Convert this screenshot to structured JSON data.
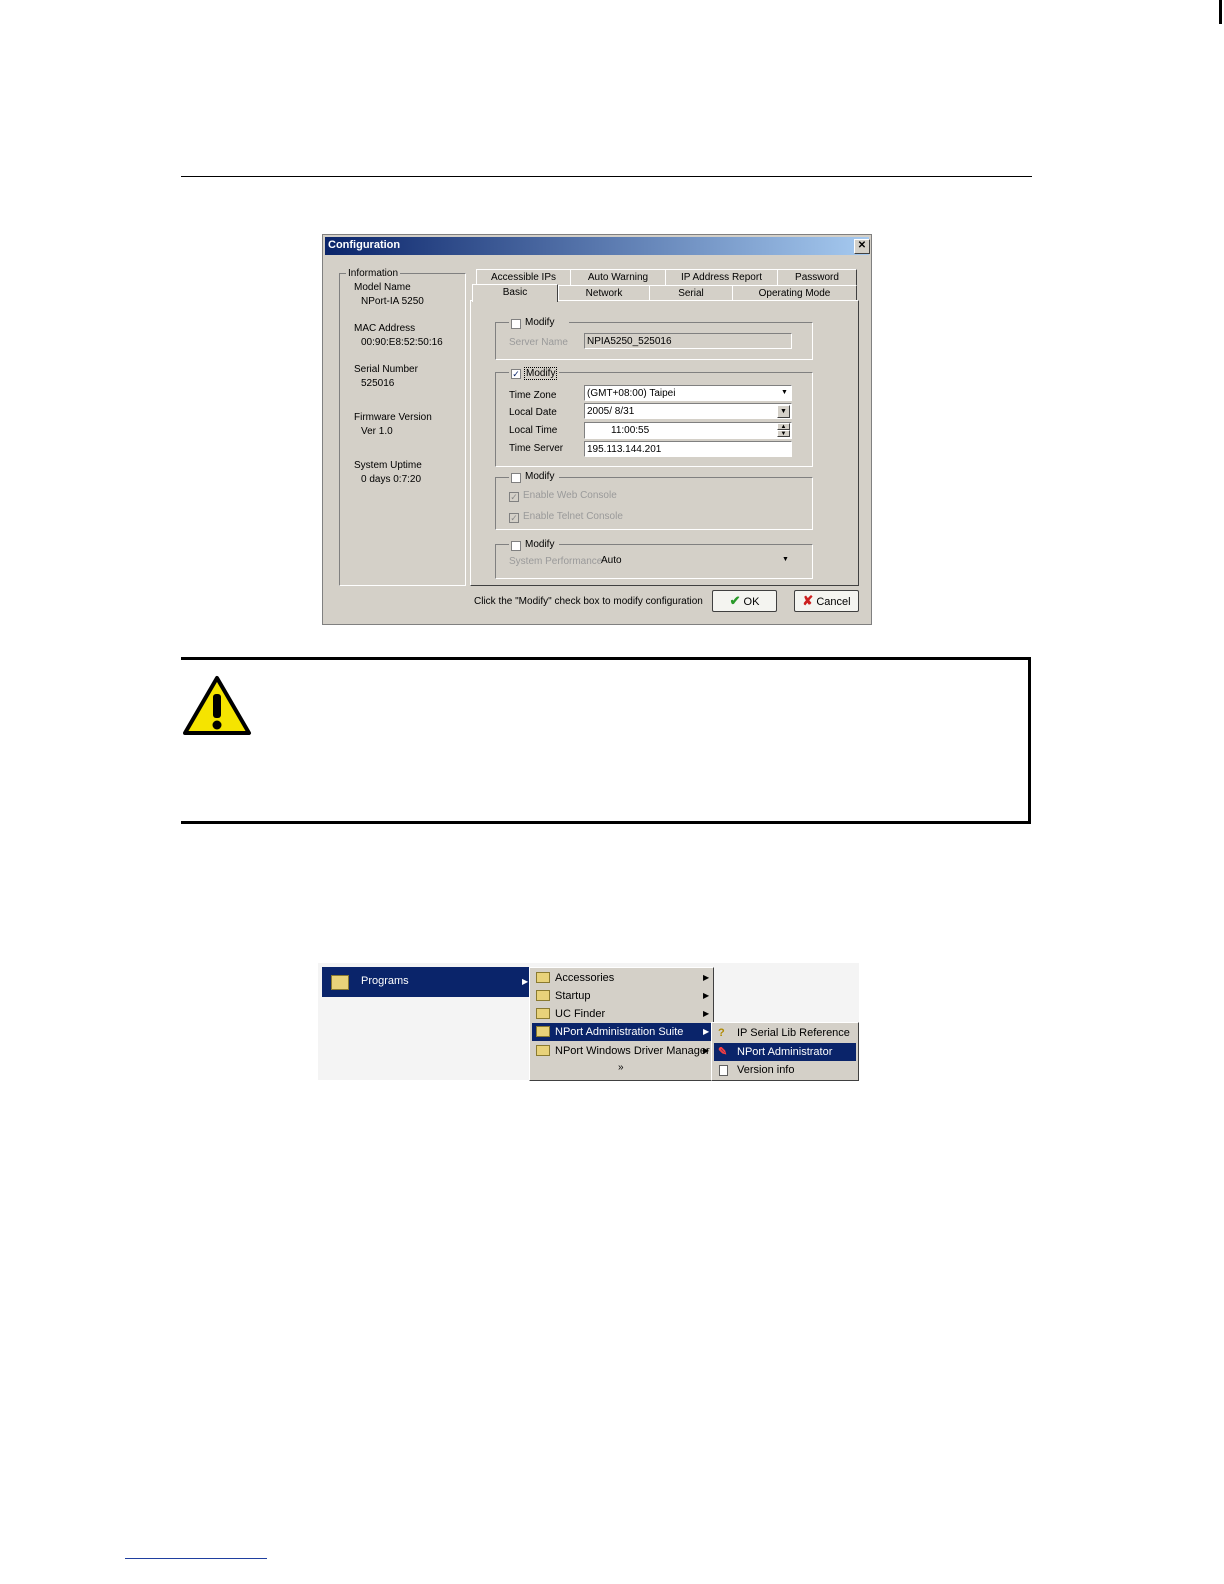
{
  "config_dialog": {
    "title": "Configuration",
    "close_glyph": "✕",
    "info": {
      "group_title": "Information",
      "model_name_label": "Model Name",
      "model_name": "NPort-IA 5250",
      "mac_label": "MAC Address",
      "mac": "00:90:E8:52:50:16",
      "serial_label": "Serial Number",
      "serial": "525016",
      "firmware_label": "Firmware Version",
      "firmware": "Ver 1.0",
      "uptime_label": "System Uptime",
      "uptime": "0 days 0:7:20"
    },
    "tabs_back": [
      "Accessible IPs",
      "Auto Warning",
      "IP Address Report",
      "Password"
    ],
    "tabs_front": [
      "Basic",
      "Network",
      "Serial",
      "Operating Mode"
    ],
    "active_tab": "Basic",
    "group1": {
      "modify_label": "Modify",
      "checked": false,
      "server_name_label": "Server Name",
      "server_name": "NPIA5250_525016"
    },
    "group2": {
      "modify_label": "Modify",
      "checked": true,
      "time_zone_label": "Time Zone",
      "time_zone": "(GMT+08:00) Taipei",
      "local_date_label": "Local Date",
      "local_date": "2005/  8/31",
      "local_time_label": "Local Time",
      "local_time": "11:00:55",
      "time_server_label": "Time Server",
      "time_server": "195.113.144.201"
    },
    "group3": {
      "modify_label": "Modify",
      "checked": false,
      "web_console": "Enable Web Console",
      "telnet_console": "Enable Telnet Console"
    },
    "group4": {
      "modify_label": "Modify",
      "checked": false,
      "perf_label": "System Performance",
      "perf_value": "Auto"
    },
    "hint": "Click the \"Modify\" check box to modify configuration",
    "ok_label": "OK",
    "cancel_label": "Cancel"
  },
  "start_menu": {
    "programs_label": "Programs",
    "submenu": [
      "Accessories",
      "Startup",
      "UC Finder",
      "NPort Administration Suite",
      "NPort Windows Driver Manager"
    ],
    "more_glyph": "»",
    "suite_items": [
      "IP Serial Lib Reference",
      "NPort Administrator",
      "Version info"
    ]
  },
  "colors": {
    "selection": "#0a246a",
    "dialog_face": "#d4d0c8",
    "warning_yellow": "#f5e400",
    "ok_green": "#2a9a2a",
    "cancel_red": "#cc1f1f"
  }
}
